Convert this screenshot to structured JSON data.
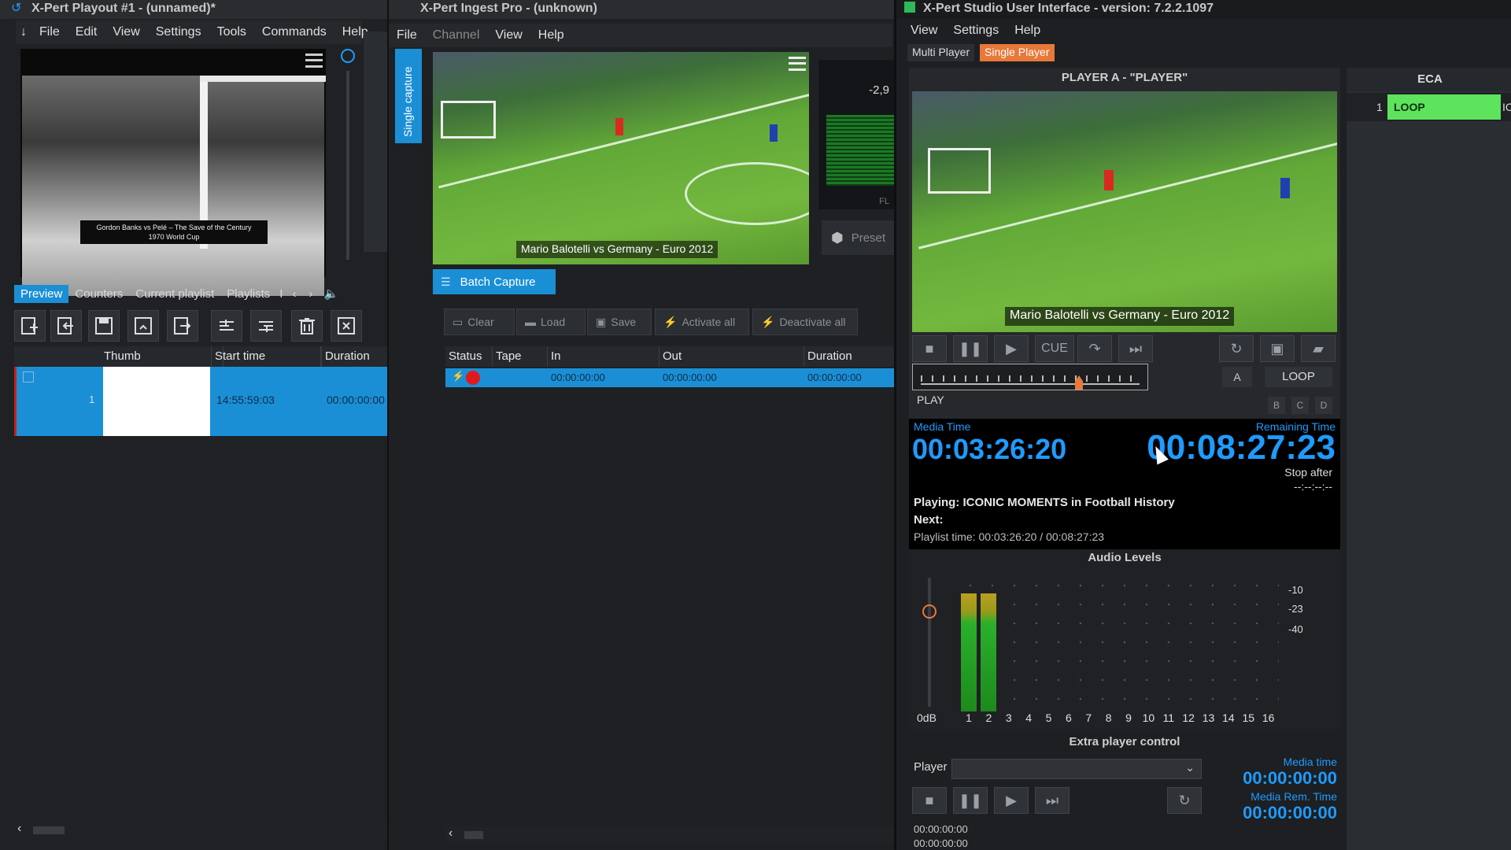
{
  "playout": {
    "title": "X-Pert Playout #1 - (unnamed)*",
    "menu": [
      "File",
      "Edit",
      "View",
      "Settings",
      "Tools",
      "Commands",
      "Help"
    ],
    "preview_caption_line1": "Gordon Banks vs Pelé – The Save of the Century",
    "preview_caption_line2": "1970 World Cup",
    "tabs": [
      "Preview",
      "Counters",
      "Current playlist",
      "Playlists",
      "I"
    ],
    "columns": [
      "Thumb",
      "Start time",
      "Duration"
    ],
    "rows": [
      {
        "index": "1",
        "start_time": "14:55:59:03",
        "duration": "00:00:00:00"
      }
    ]
  },
  "ingest": {
    "title": "X-Pert Ingest Pro - (unknown)",
    "menu": [
      "File",
      "Channel",
      "View",
      "Help"
    ],
    "side_tab": "Single capture",
    "video_caption": "Mario Balotelli vs Germany - Euro 2012",
    "meter_value": "-2,9",
    "meter_label": "FL",
    "preset_label": "Preset",
    "batch_tab": "Batch Capture",
    "buttons": [
      "Clear",
      "Load",
      "Save",
      "Activate all",
      "Deactivate all"
    ],
    "columns": [
      "Status",
      "Tape",
      "In",
      "Out",
      "Duration"
    ],
    "rows": [
      {
        "in": "00:00:00:00",
        "out": "00:00:00:00",
        "duration": "00:00:00:00"
      }
    ]
  },
  "studio": {
    "title": "X-Pert Studio User Interface - version: 7.2.2.1097",
    "menu": [
      "View",
      "Settings",
      "Help"
    ],
    "modes": [
      "Multi Player",
      "Single Player"
    ],
    "player_title": "PLAYER A - \"PLAYER\"",
    "video_caption": "Mario Balotelli vs Germany - Euro 2012",
    "cue_label": "CUE",
    "channel_a": "A",
    "loop_label": "LOOP",
    "play_state": "PLAY",
    "bcd": [
      "B",
      "C",
      "D"
    ],
    "media_time_label": "Media Time",
    "media_time": "00:03:26:20",
    "remaining_label": "Remaining Time",
    "remaining_time": "00:08:27:23",
    "stop_after_label": "Stop after",
    "stop_after_value": "--:--:--:--",
    "playing_text": "Playing: ICONIC MOMENTS in Football History",
    "next_text": "Next:",
    "playlist_time": "Playlist time: 00:03:26:20 / 00:08:27:23",
    "audio_title": "Audio Levels",
    "db_marks": [
      "-10",
      "-23",
      "-40"
    ],
    "zero_db": "0dB",
    "channels": [
      "1",
      "2",
      "3",
      "4",
      "5",
      "6",
      "7",
      "8",
      "9",
      "10",
      "11",
      "12",
      "13",
      "14",
      "15",
      "16"
    ],
    "channel_levels": [
      0.87,
      0.87,
      0,
      0,
      0,
      0,
      0,
      0,
      0,
      0,
      0,
      0,
      0,
      0,
      0,
      0
    ],
    "extra_title": "Extra player control",
    "player_label": "Player",
    "extra_media_time_label": "Media time",
    "extra_media_time": "00:00:00:00",
    "extra_rem_label": "Media Rem. Time",
    "extra_rem_time": "00:00:00:00",
    "bottom_times": [
      "00:00:00:00",
      "00:00:00:00"
    ],
    "eca_title": "ECA",
    "eca_row_index": "1",
    "eca_row_label": "LOOP",
    "eca_row_extra": "IC"
  },
  "colors": {
    "accent_blue": "#1e9bff",
    "selection_blue": "#1b8fd6",
    "single_player_orange": "#e8783a",
    "loop_green": "#5ee35e"
  }
}
